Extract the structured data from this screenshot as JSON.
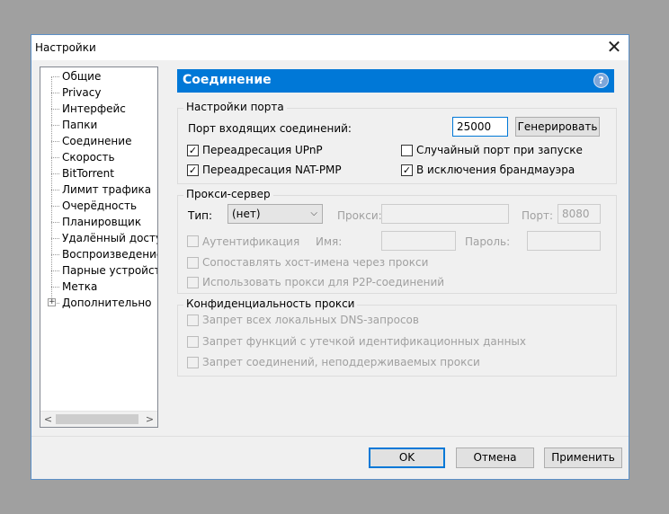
{
  "window": {
    "title": "Настройки"
  },
  "tree": {
    "items": [
      "Общие",
      "Privacy",
      "Интерфейс",
      "Папки",
      "Соединение",
      "Скорость",
      "BitTorrent",
      "Лимит трафика",
      "Очерёдность",
      "Планировщик",
      "Удалённый доступ",
      "Воспроизведение",
      "Парные устройства",
      "Метка",
      "Дополнительно"
    ],
    "selected": "Соединение"
  },
  "header": {
    "title": "Соединение",
    "help": "?"
  },
  "port_settings": {
    "title": "Настройки порта",
    "port_label": "Порт входящих соединений:",
    "port_value": "25000",
    "generate_label": "Генерировать",
    "upnp_label": "Переадресация UPnP",
    "upnp_checked": true,
    "natpmp_label": "Переадресация NAT-PMP",
    "natpmp_checked": true,
    "random_port_label": "Случайный порт при запуске",
    "random_port_checked": false,
    "firewall_label": "В исключения брандмауэра",
    "firewall_checked": true
  },
  "proxy": {
    "title": "Прокси-сервер",
    "type_label": "Тип:",
    "type_value": "(нет)",
    "proxy_label": "Прокси:",
    "port_label": "Порт:",
    "port_value": "8080",
    "auth_label": "Аутентификация",
    "name_label": "Имя:",
    "password_label": "Пароль:",
    "hostname_label": "Сопоставлять хост-имена через прокси",
    "p2p_label": "Использовать прокси для P2P-соединений"
  },
  "privacy": {
    "title": "Конфиденциальность прокси",
    "dns_label": "Запрет всех локальных DNS-запросов",
    "leak_label": "Запрет функций с утечкой идентификационных данных",
    "unsupported_label": "Запрет соединений, неподдерживаемых прокси"
  },
  "buttons": {
    "ok": "OK",
    "cancel": "Отмена",
    "apply": "Применить"
  },
  "icons": {
    "check": "✓",
    "close": "✕",
    "chevron_down": "⌵",
    "left": "<",
    "right": ">"
  }
}
